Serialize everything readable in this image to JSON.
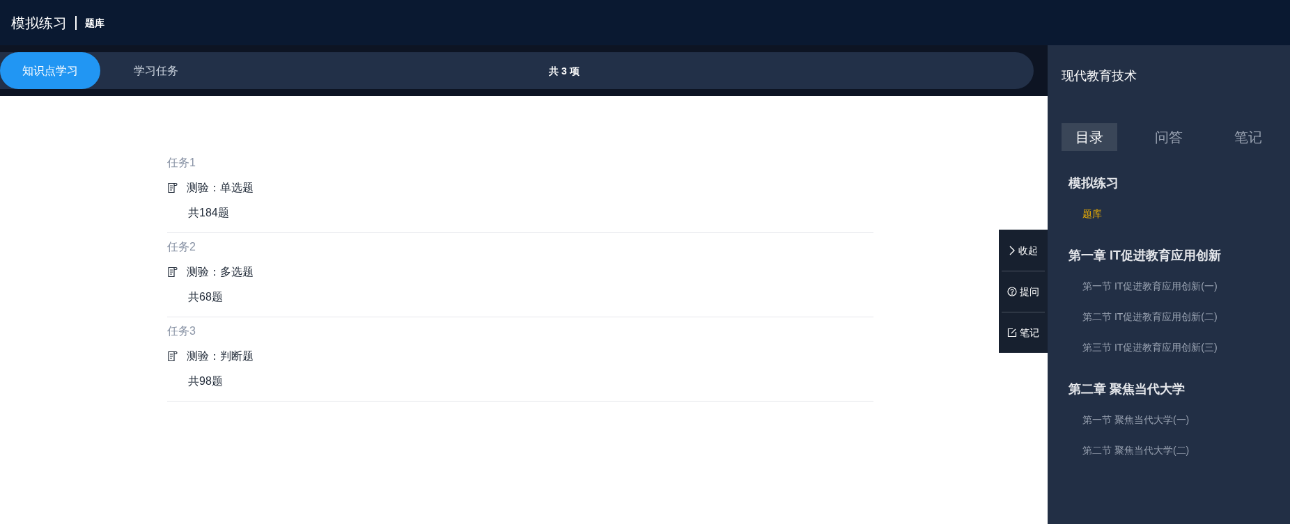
{
  "header": {
    "title": "模拟练习",
    "subtitle": "题库"
  },
  "tabs": [
    {
      "label": "知识点学习",
      "selected": true
    },
    {
      "label": "学习任务",
      "selected": false
    }
  ],
  "count": "共 3 项",
  "tasks": [
    {
      "label": "任务1",
      "name": "测验：单选题",
      "total": "共184题"
    },
    {
      "label": "任务2",
      "name": "测验：多选题",
      "total": "共68题"
    },
    {
      "label": "任务3",
      "name": "测验：判断题",
      "total": "共98题"
    }
  ],
  "float_menu": [
    {
      "kind": "collapse",
      "label": "收起"
    },
    {
      "kind": "ask",
      "label": "提问"
    },
    {
      "kind": "note",
      "label": "笔记"
    }
  ],
  "sidebar": {
    "title": "现代教育技术",
    "tabs": [
      {
        "label": "目录",
        "selected": true
      },
      {
        "label": "问答",
        "selected": false
      },
      {
        "label": "笔记",
        "selected": false
      }
    ],
    "sections": [
      {
        "title": "模拟练习",
        "items": [
          {
            "label": "题库",
            "selected": true
          }
        ]
      },
      {
        "title": "第一章 IT促进教育应用创新",
        "items": [
          {
            "label": "第一节 IT促进教育应用创新(一)",
            "selected": false
          },
          {
            "label": "第二节 IT促进教育应用创新(二)",
            "selected": false
          },
          {
            "label": "第三节 IT促进教育应用创新(三)",
            "selected": false
          }
        ]
      },
      {
        "title": "第二章 聚焦当代大学",
        "items": [
          {
            "label": "第一节 聚焦当代大学(一)",
            "selected": false
          },
          {
            "label": "第二节 聚焦当代大学(二)",
            "selected": false
          }
        ]
      }
    ]
  }
}
